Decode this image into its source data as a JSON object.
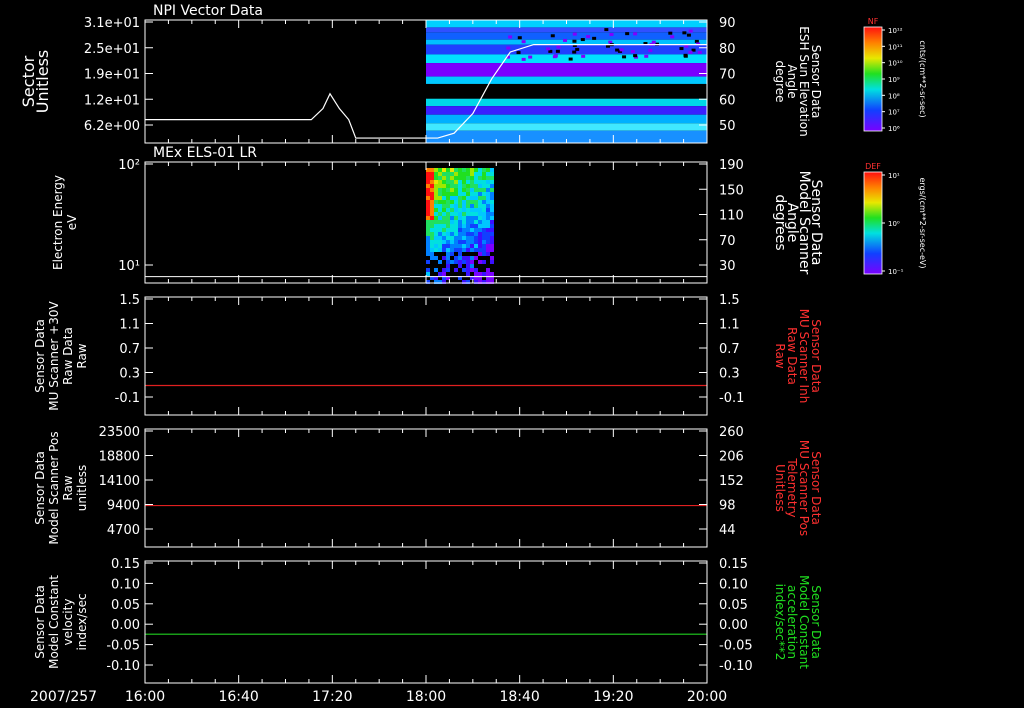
{
  "date_label": "2007/257",
  "time_ticks": [
    "16:00",
    "16:40",
    "17:20",
    "18:00",
    "18:40",
    "19:20",
    "20:00"
  ],
  "colorbars": [
    {
      "title": "NF",
      "unit": "cnts/(cm**2-sr-sec)",
      "tick_labels": [
        "10¹²",
        "10¹¹",
        "10¹⁰",
        "10⁹",
        "10⁸",
        "10⁷",
        "10⁶"
      ]
    },
    {
      "title": "DEF",
      "unit": "ergs/(cm**2-sr-sec-eV)",
      "tick_labels": [
        "10¹",
        "10⁰",
        "10⁻¹"
      ]
    }
  ],
  "chart_data": [
    {
      "type": "heatmap",
      "title": "NPI Vector Data",
      "ylabel": [
        "Sector",
        "Unitless"
      ],
      "y_ticks": [
        "3.1e+01",
        "2.5e+01",
        "1.9e+01",
        "1.2e+01",
        "6.2e+00"
      ],
      "y2label": [
        "Sensor Data",
        "ESH Sun Elevation",
        "Angle",
        "degree"
      ],
      "y2_ticks": [
        "90",
        "80",
        "70",
        "60",
        "50"
      ],
      "y2lim": [
        40,
        90
      ],
      "overlay_line": {
        "x": [
          "16:00",
          "17:11",
          "17:16",
          "17:19",
          "17:23",
          "17:27",
          "17:30",
          "18:05",
          "18:12",
          "18:20",
          "18:28",
          "18:36",
          "18:46",
          "18:52",
          "20:00"
        ],
        "y": [
          49.5,
          49.5,
          54,
          60,
          54,
          49.5,
          42,
          42,
          44,
          52,
          66,
          77,
          80,
          80,
          80
        ]
      },
      "data_time_range": [
        "18:00",
        "20:00"
      ]
    },
    {
      "type": "heatmap",
      "title": "MEx ELS-01 LR",
      "ylabel": [
        "Electron Energy",
        "eV"
      ],
      "y_ticks": [
        "10²",
        "10¹"
      ],
      "y2label": [
        "Sensor Data",
        "Model Scanner",
        "Angle",
        "degrees"
      ],
      "y2_ticks": [
        "190",
        "150",
        "110",
        "70",
        "30"
      ],
      "y2lim": [
        0,
        190
      ],
      "overlay_line": {
        "x": [
          "16:00",
          "20:00"
        ],
        "y": [
          10,
          10
        ]
      },
      "data_time_range": [
        "18:00",
        "18:28"
      ]
    },
    {
      "type": "line",
      "ylabel": [
        "Sensor Data",
        "MU Scanner +30V",
        "Raw Data",
        "Raw"
      ],
      "y_ticks": [
        "1.5",
        "1.1",
        "0.7",
        "0.3",
        "-0.1"
      ],
      "y2label": [
        "Sensor Data",
        "MU Scanner Inh",
        "Raw Data",
        "Raw"
      ],
      "y2_ticks": [
        "1.5",
        "1.1",
        "0.7",
        "0.3",
        "-0.1"
      ],
      "ylim": [
        -0.5,
        1.5
      ],
      "series": [
        {
          "x": [
            "16:00",
            "20:00"
          ],
          "y": [
            0,
            0
          ],
          "color": "#e02020"
        }
      ]
    },
    {
      "type": "line",
      "ylabel": [
        "Sensor Data",
        "Model Scanner Pos",
        "Raw",
        "unitless"
      ],
      "y_ticks": [
        "23500",
        "18800",
        "14100",
        "9400",
        "4700"
      ],
      "y2label": [
        "Sensor Data",
        "MU Scanner Pos",
        "Telemetry",
        "Unitless"
      ],
      "y2_ticks": [
        "260",
        "206",
        "152",
        "98",
        "44"
      ],
      "ylim": [
        0,
        23500
      ],
      "series": [
        {
          "x": [
            "16:00",
            "20:00"
          ],
          "y": [
            8250,
            8250
          ],
          "color": "#e02020"
        }
      ]
    },
    {
      "type": "line",
      "ylabel": [
        "Sensor Data",
        "Model Constant",
        "velocity",
        "index/sec"
      ],
      "y_ticks": [
        "0.15",
        "0.10",
        "0.05",
        "0.00",
        "-0.05",
        "-0.10"
      ],
      "y2label": [
        "Sensor Data",
        "Model Constant",
        "acceleration",
        "index/sec**2"
      ],
      "y2_ticks": [
        "0.15",
        "0.10",
        "0.05",
        "0.00",
        "-0.05",
        "-0.10"
      ],
      "ylim": [
        -0.1,
        0.15
      ],
      "series": [
        {
          "x": [
            "16:00",
            "20:00"
          ],
          "y": [
            0,
            0
          ],
          "color": "#20d020"
        }
      ]
    }
  ]
}
